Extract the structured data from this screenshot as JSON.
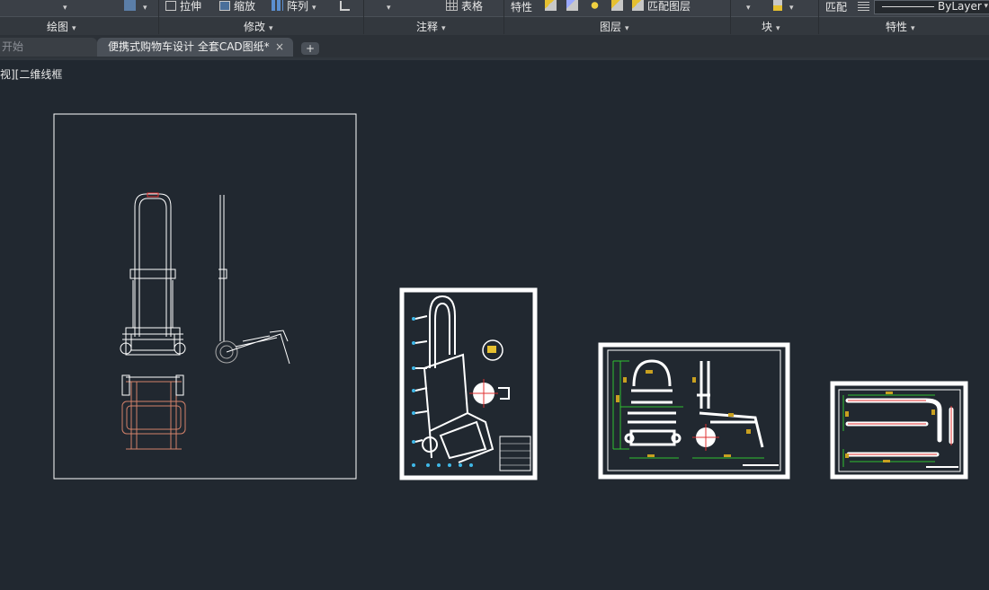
{
  "ribbon": {
    "row1": {
      "stretch": "拉伸",
      "scale": "缩放",
      "array": "阵列",
      "table": "表格",
      "properties": "特性",
      "match_layer": "匹配图层",
      "match": "匹配",
      "bylayer": "ByLayer"
    },
    "panels": {
      "draw": "绘图",
      "modify": "修改",
      "annotation": "注释",
      "layers": "图层",
      "block": "块",
      "properties": "特性"
    }
  },
  "tabs": {
    "start": "开始",
    "document": "便携式购物车设计 全套CAD图纸*",
    "close": "×",
    "new": "+"
  },
  "viewport": {
    "label": "视][二维线框"
  },
  "colors": {
    "canvas_bg": "#212830",
    "ribbon_bg": "#3b4047",
    "drawing_line": "#ffffff",
    "red_line": "#e03030",
    "green_line": "#30c030",
    "yellow_text": "#c8a020",
    "cyan_callout": "#3fb8e8",
    "copper": "#d4826a"
  }
}
